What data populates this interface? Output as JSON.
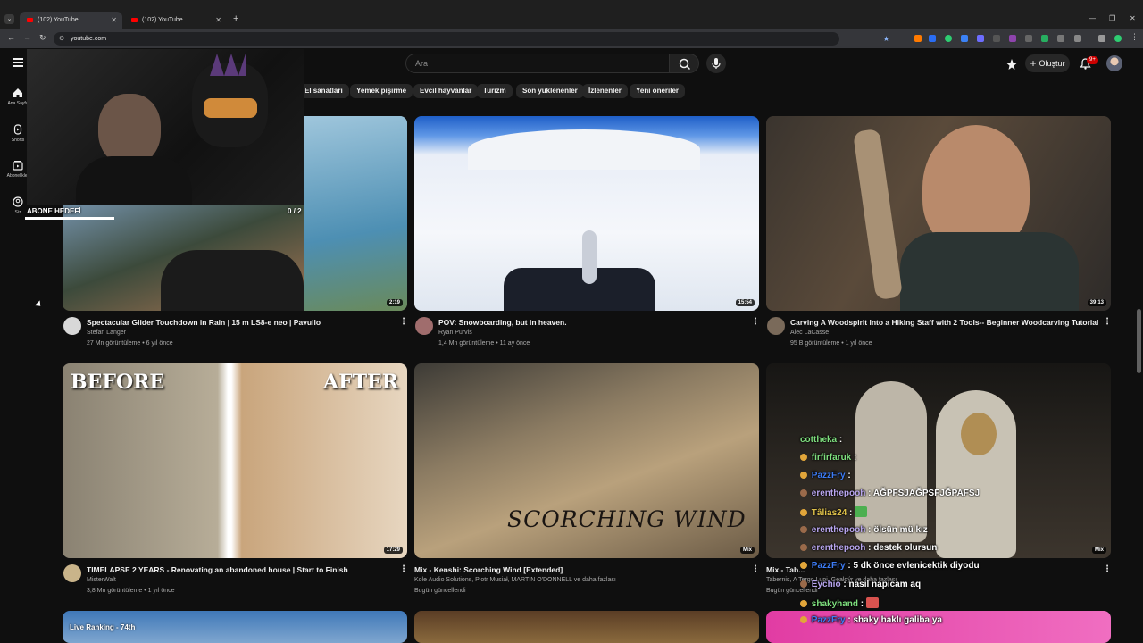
{
  "browser": {
    "tabs": [
      {
        "title": "(102) YouTube",
        "active": true
      },
      {
        "title": "(102) YouTube",
        "active": false
      }
    ],
    "address": "youtube.com"
  },
  "header": {
    "search_placeholder": "Ara",
    "create_label": "Oluştur",
    "notifications_badge": "9+"
  },
  "sidebar": {
    "items": [
      {
        "label": "Ana Sayfa",
        "icon": "home-icon"
      },
      {
        "label": "Shorts",
        "icon": "shorts-icon"
      },
      {
        "label": "Abonelikler",
        "icon": "subscriptions-icon"
      },
      {
        "label": "Siz",
        "icon": "you-icon"
      }
    ]
  },
  "chips": [
    "El sanatları",
    "Yemek pişirme",
    "Evcil hayvanlar",
    "Turizm",
    "Son yüklenenler",
    "İzlenenler",
    "Yeni öneriler"
  ],
  "overlay": {
    "subscriber_goal_label": "ABONE HEDEFİ",
    "subscriber_goal_value": "0 / 2",
    "thumbnail_label_before": "BEFORE",
    "thumbnail_label_after": "AFTER",
    "thumbnail_label_scorching": "SCORCHING WIND",
    "thumbnail_label_live": "Live Ranking - 74th"
  },
  "videos": [
    {
      "title": "Spectacular Glider Touchdown in Rain | 15 m LS8-e neo | Pavullo",
      "channel": "Stefan Langer",
      "views": "27 Mn görüntüleme • 6 yıl önce",
      "duration": "2:19"
    },
    {
      "title": "POV: Snowboarding, but in heaven.",
      "channel": "Ryan Purvis",
      "views": "1,4 Mn görüntüleme • 11 ay önce",
      "duration": "15:54"
    },
    {
      "title": "Carving A Woodspirit Into a Hiking Staff with 2 Tools-- Beginner  Woodcarving Tutorial",
      "channel": "Alec LaCasse",
      "views": "95 B görüntüleme • 1 yıl önce",
      "duration": "39:13"
    },
    {
      "title": "TIMELAPSE 2 YEARS - Renovating an abandoned house | Start to Finish",
      "channel": "MisterWalt",
      "views": "3,8 Mn görüntüleme • 1 yıl önce",
      "duration": "17:29"
    },
    {
      "title": "Mix - Kenshi: Scorching Wind [Extended]",
      "channel": "Kole Audio Solutions, Piotr Musiał, MARTIN O'DONNELL ve daha fazlası",
      "views": "Bugün güncellendi",
      "duration": "Mix"
    },
    {
      "title": "Mix - Tab...",
      "channel": "Tabernis, A Tergo Lupi, Gealdýr ve daha fazlası",
      "views": "Bugün güncellendi",
      "duration": "Mix"
    }
  ],
  "chat": [
    {
      "user": "cottheka",
      "message": "",
      "color": "green"
    },
    {
      "user": "firfirfaruk",
      "message": "",
      "color": "green"
    },
    {
      "user": "PazzFry",
      "message": "",
      "color": "blue"
    },
    {
      "user": "erenthepooh",
      "message": "AĞPFSJAĞPSFJĞPAFSJ",
      "color": "purple"
    },
    {
      "user": "Tâlias24",
      "message": "",
      "color": "yellow"
    },
    {
      "user": "erenthepooh",
      "message": "ölsün mü kız",
      "color": "purple"
    },
    {
      "user": "erenthepooh",
      "message": "destek olursun",
      "color": "purple"
    },
    {
      "user": "PazzFry",
      "message": "5 dk önce evlenicektik diyodu",
      "color": "blue"
    },
    {
      "user": "Eychio",
      "message": "nasıl napicam aq",
      "color": "purple"
    },
    {
      "user": "shakyhand",
      "message": "",
      "color": "green"
    },
    {
      "user": "PazzFry",
      "message": "shaky haklı galiba ya",
      "color": "blue"
    }
  ]
}
